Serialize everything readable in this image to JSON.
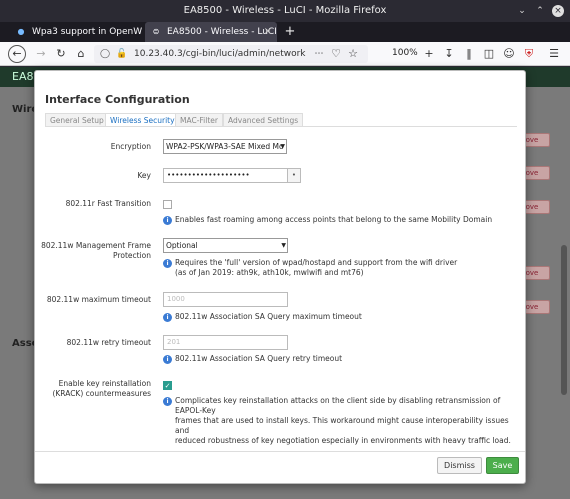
{
  "window": {
    "title": "EA8500 - Wireless - LuCI - Mozilla Firefox"
  },
  "tabs": [
    {
      "label": "Wpa3 support in OpenW"
    },
    {
      "label": "EA8500 - Wireless - LuCI"
    }
  ],
  "nav": {
    "url": "10.23.40.3/cgi-bin/luci/admin/network",
    "zoom": "100%"
  },
  "page": {
    "header": "EA8",
    "bg_heading_1": "Wire",
    "bg_heading_2": "Asso",
    "bg_btn_label": "ove"
  },
  "modal": {
    "title": "Interface Configuration",
    "tabs": [
      "General Setup",
      "Wireless Security",
      "MAC-Filter",
      "Advanced Settings"
    ],
    "fields": {
      "encryption": {
        "label": "Encryption",
        "value": "WPA2-PSK/WPA3-SAE Mixed Mo"
      },
      "key": {
        "label": "Key",
        "value": "••••••••••••••••••••"
      },
      "fast_transition": {
        "label": "802.11r Fast Transition",
        "help": "Enables fast roaming among access points that belong to the same Mobility Domain"
      },
      "mfp": {
        "label_1": "802.11w Management Frame",
        "label_2": "Protection",
        "value": "Optional",
        "help_1": "Requires the 'full' version of wpad/hostapd and support from the wifi driver",
        "help_2": "(as of Jan 2019: ath9k, ath10k, mwlwifi and mt76)"
      },
      "max_timeout": {
        "label": "802.11w maximum timeout",
        "placeholder": "1000",
        "help": "802.11w Association SA Query maximum timeout"
      },
      "retry_timeout": {
        "label": "802.11w retry timeout",
        "placeholder": "201",
        "help": "802.11w Association SA Query retry timeout"
      },
      "krack": {
        "label_1": "Enable key reinstallation",
        "label_2": "(KRACK) countermeasures",
        "help_1": "Complicates key reinstallation attacks on the client side by disabling retransmission of EAPOL-Key",
        "help_2": "frames that are used to install keys. This workaround might cause interoperability issues and",
        "help_3": "reduced robustness of key negotiation especially in environments with heavy traffic load."
      }
    },
    "buttons": {
      "dismiss": "Dismiss",
      "save": "Save"
    }
  },
  "colors": {
    "accent": "#1a6fc2",
    "save": "#4cae4c",
    "help_icon": "#3b7bd4"
  }
}
